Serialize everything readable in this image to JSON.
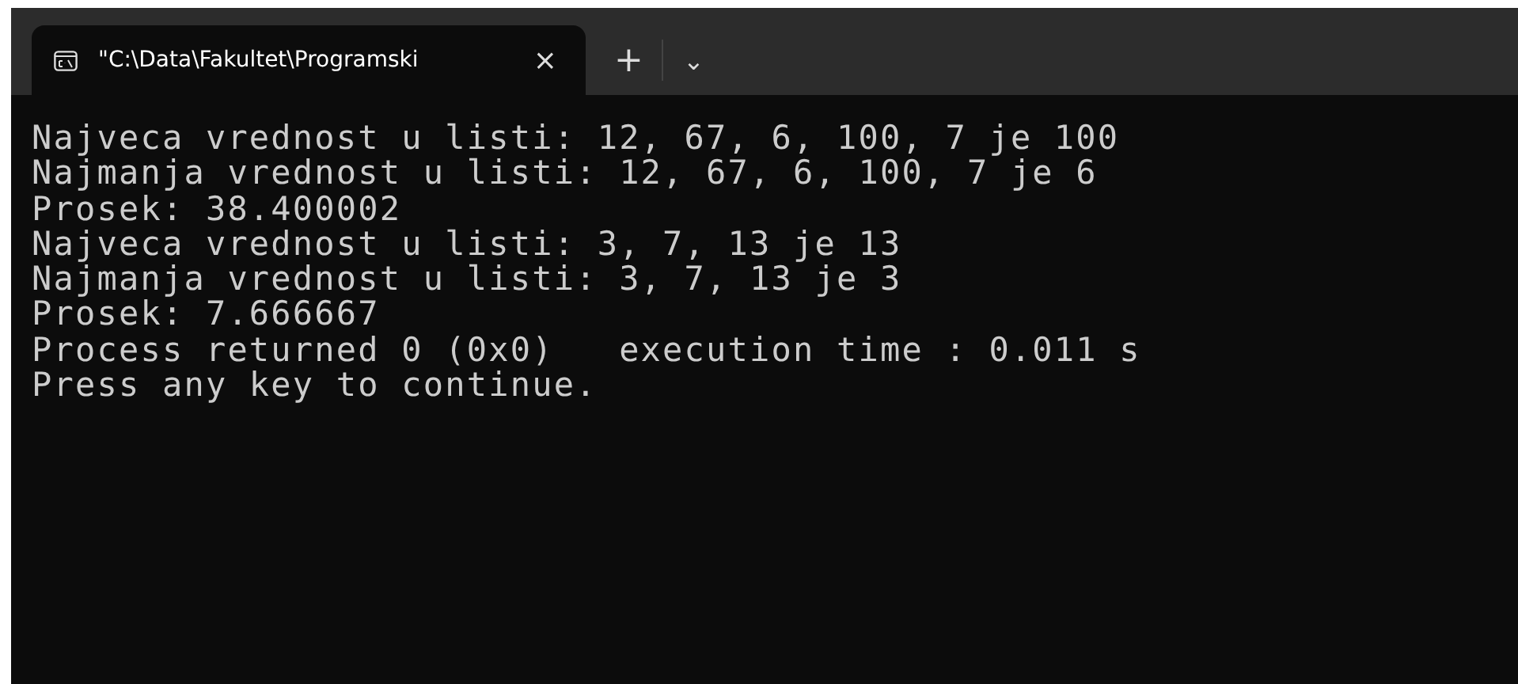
{
  "window": {
    "tabs": [
      {
        "title": "\"C:\\Data\\Fakultet\\Programski",
        "selected": true,
        "close": "×"
      }
    ],
    "new_tab": "+",
    "dropdown": "⌄"
  },
  "console": {
    "lines": [
      "Najveca vrednost u listi: 12, 67, 6, 100, 7 je 100",
      "Najmanja vrednost u listi: 12, 67, 6, 100, 7 je 6",
      "Prosek: 38.400002",
      "Najveca vrednost u listi: 3, 7, 13 je 13",
      "Najmanja vrednost u listi: 3, 7, 13 je 3",
      "Prosek: 7.666667",
      "Process returned 0 (0x0)   execution time : 0.011 s",
      "Press any key to continue."
    ]
  }
}
